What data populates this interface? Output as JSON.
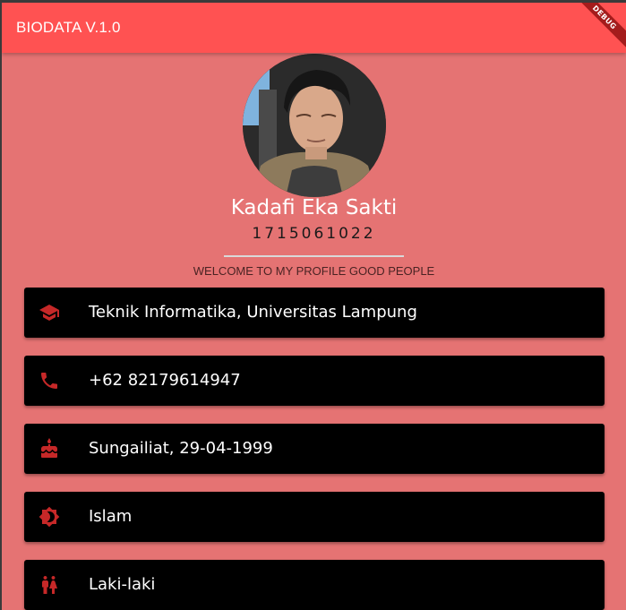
{
  "appbar": {
    "title": "BIODATA V.1.0",
    "debug_banner": "DEBUG"
  },
  "profile": {
    "name": "Kadafi Eka Sakti",
    "nim": "1715061022",
    "welcome": "WELCOME TO MY PROFILE GOOD PEOPLE"
  },
  "cards": [
    {
      "icon": "school-icon",
      "label": "Teknik Informatika, Universitas Lampung"
    },
    {
      "icon": "phone-icon",
      "label": "+62 82179614947"
    },
    {
      "icon": "cake-icon",
      "label": "Sungailiat, 29-04-1999"
    },
    {
      "icon": "brightness-icon",
      "label": "Islam"
    },
    {
      "icon": "wc-icon",
      "label": "Laki-laki"
    }
  ],
  "colors": {
    "appbar": "#ff5252",
    "background": "#e57373",
    "card": "#000000",
    "icon": "#c62828",
    "debug_banner": "#a41c1c"
  }
}
